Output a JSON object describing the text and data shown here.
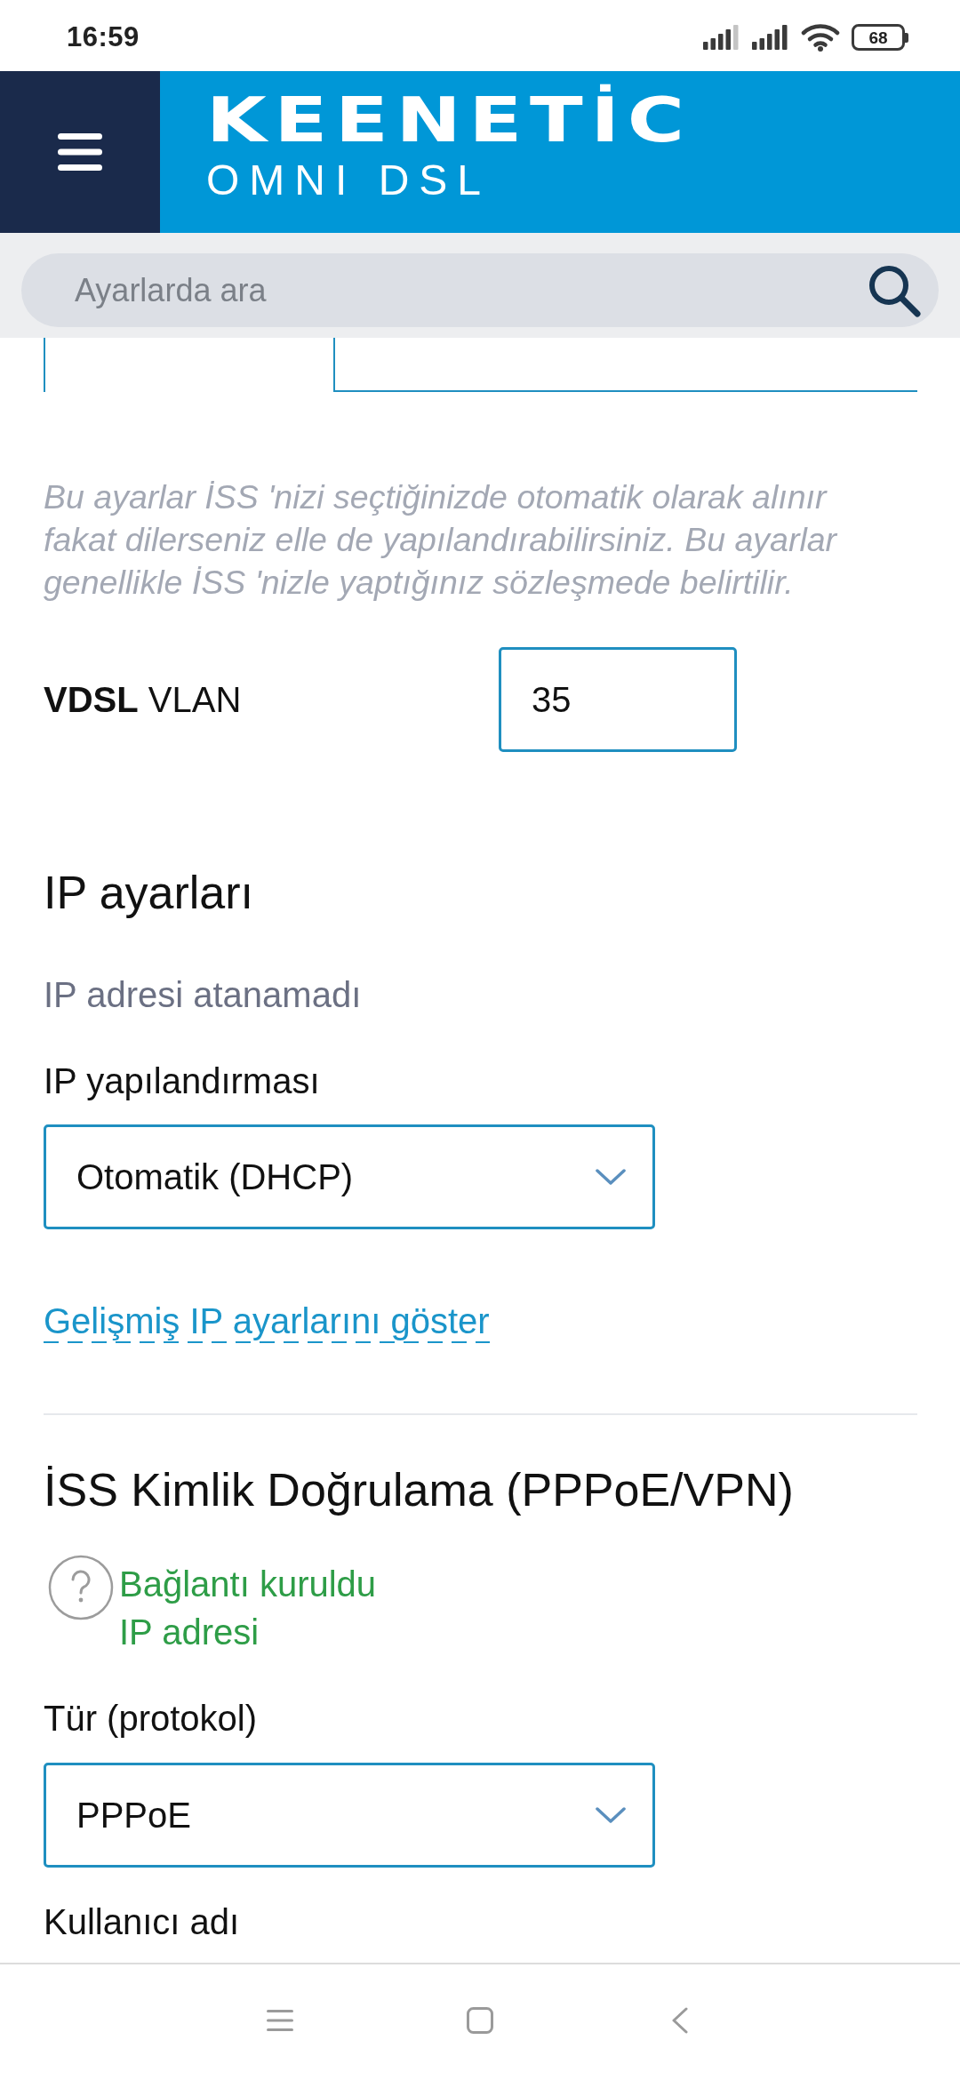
{
  "status_bar": {
    "time": "16:59",
    "battery": "68"
  },
  "header": {
    "logo": "KEENETİC",
    "model": "OMNI DSL"
  },
  "search": {
    "placeholder": "Ayarlarda ara"
  },
  "description": "Bu ayarlar İSS 'nizi seçtiğinizde otomatik olarak alınır fakat dilerseniz elle de yapılandırabilirsiniz. Bu ayarlar genellikle İSS 'nizle yaptığınız sözleşmede belirtilir.",
  "vlan": {
    "label": "**VDSL** VLAN",
    "value": "35"
  },
  "ip_settings": {
    "title": "IP ayarları",
    "status": "IP adresi atanamadı",
    "config_label": "IP yapılandırması",
    "config_value": "Otomatik (DHCP)",
    "advanced_link": "Gelişmiş IP ayarlarını göster"
  },
  "auth": {
    "title": "İSS Kimlik Doğrulama (PPPoE/VPN)",
    "status": {
      "connected": true,
      "lines": [
        "Bağlantı kuruldu",
        "IP adresi"
      ]
    },
    "protocol_label": "Tür (protokol)",
    "protocol_value": "PPPoE",
    "username_label": "Kullanıcı adı"
  }
}
